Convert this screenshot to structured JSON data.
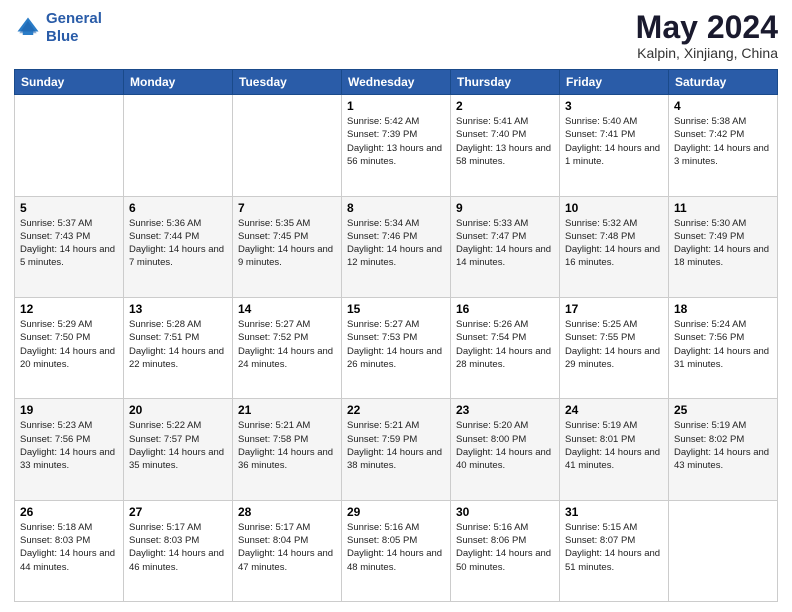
{
  "logo": {
    "line1": "General",
    "line2": "Blue"
  },
  "title": "May 2024",
  "subtitle": "Kalpin, Xinjiang, China",
  "days_of_week": [
    "Sunday",
    "Monday",
    "Tuesday",
    "Wednesday",
    "Thursday",
    "Friday",
    "Saturday"
  ],
  "weeks": [
    [
      {
        "day": "",
        "sunrise": "",
        "sunset": "",
        "daylight": ""
      },
      {
        "day": "",
        "sunrise": "",
        "sunset": "",
        "daylight": ""
      },
      {
        "day": "",
        "sunrise": "",
        "sunset": "",
        "daylight": ""
      },
      {
        "day": "1",
        "sunrise": "Sunrise: 5:42 AM",
        "sunset": "Sunset: 7:39 PM",
        "daylight": "Daylight: 13 hours and 56 minutes."
      },
      {
        "day": "2",
        "sunrise": "Sunrise: 5:41 AM",
        "sunset": "Sunset: 7:40 PM",
        "daylight": "Daylight: 13 hours and 58 minutes."
      },
      {
        "day": "3",
        "sunrise": "Sunrise: 5:40 AM",
        "sunset": "Sunset: 7:41 PM",
        "daylight": "Daylight: 14 hours and 1 minute."
      },
      {
        "day": "4",
        "sunrise": "Sunrise: 5:38 AM",
        "sunset": "Sunset: 7:42 PM",
        "daylight": "Daylight: 14 hours and 3 minutes."
      }
    ],
    [
      {
        "day": "5",
        "sunrise": "Sunrise: 5:37 AM",
        "sunset": "Sunset: 7:43 PM",
        "daylight": "Daylight: 14 hours and 5 minutes."
      },
      {
        "day": "6",
        "sunrise": "Sunrise: 5:36 AM",
        "sunset": "Sunset: 7:44 PM",
        "daylight": "Daylight: 14 hours and 7 minutes."
      },
      {
        "day": "7",
        "sunrise": "Sunrise: 5:35 AM",
        "sunset": "Sunset: 7:45 PM",
        "daylight": "Daylight: 14 hours and 9 minutes."
      },
      {
        "day": "8",
        "sunrise": "Sunrise: 5:34 AM",
        "sunset": "Sunset: 7:46 PM",
        "daylight": "Daylight: 14 hours and 12 minutes."
      },
      {
        "day": "9",
        "sunrise": "Sunrise: 5:33 AM",
        "sunset": "Sunset: 7:47 PM",
        "daylight": "Daylight: 14 hours and 14 minutes."
      },
      {
        "day": "10",
        "sunrise": "Sunrise: 5:32 AM",
        "sunset": "Sunset: 7:48 PM",
        "daylight": "Daylight: 14 hours and 16 minutes."
      },
      {
        "day": "11",
        "sunrise": "Sunrise: 5:30 AM",
        "sunset": "Sunset: 7:49 PM",
        "daylight": "Daylight: 14 hours and 18 minutes."
      }
    ],
    [
      {
        "day": "12",
        "sunrise": "Sunrise: 5:29 AM",
        "sunset": "Sunset: 7:50 PM",
        "daylight": "Daylight: 14 hours and 20 minutes."
      },
      {
        "day": "13",
        "sunrise": "Sunrise: 5:28 AM",
        "sunset": "Sunset: 7:51 PM",
        "daylight": "Daylight: 14 hours and 22 minutes."
      },
      {
        "day": "14",
        "sunrise": "Sunrise: 5:27 AM",
        "sunset": "Sunset: 7:52 PM",
        "daylight": "Daylight: 14 hours and 24 minutes."
      },
      {
        "day": "15",
        "sunrise": "Sunrise: 5:27 AM",
        "sunset": "Sunset: 7:53 PM",
        "daylight": "Daylight: 14 hours and 26 minutes."
      },
      {
        "day": "16",
        "sunrise": "Sunrise: 5:26 AM",
        "sunset": "Sunset: 7:54 PM",
        "daylight": "Daylight: 14 hours and 28 minutes."
      },
      {
        "day": "17",
        "sunrise": "Sunrise: 5:25 AM",
        "sunset": "Sunset: 7:55 PM",
        "daylight": "Daylight: 14 hours and 29 minutes."
      },
      {
        "day": "18",
        "sunrise": "Sunrise: 5:24 AM",
        "sunset": "Sunset: 7:56 PM",
        "daylight": "Daylight: 14 hours and 31 minutes."
      }
    ],
    [
      {
        "day": "19",
        "sunrise": "Sunrise: 5:23 AM",
        "sunset": "Sunset: 7:56 PM",
        "daylight": "Daylight: 14 hours and 33 minutes."
      },
      {
        "day": "20",
        "sunrise": "Sunrise: 5:22 AM",
        "sunset": "Sunset: 7:57 PM",
        "daylight": "Daylight: 14 hours and 35 minutes."
      },
      {
        "day": "21",
        "sunrise": "Sunrise: 5:21 AM",
        "sunset": "Sunset: 7:58 PM",
        "daylight": "Daylight: 14 hours and 36 minutes."
      },
      {
        "day": "22",
        "sunrise": "Sunrise: 5:21 AM",
        "sunset": "Sunset: 7:59 PM",
        "daylight": "Daylight: 14 hours and 38 minutes."
      },
      {
        "day": "23",
        "sunrise": "Sunrise: 5:20 AM",
        "sunset": "Sunset: 8:00 PM",
        "daylight": "Daylight: 14 hours and 40 minutes."
      },
      {
        "day": "24",
        "sunrise": "Sunrise: 5:19 AM",
        "sunset": "Sunset: 8:01 PM",
        "daylight": "Daylight: 14 hours and 41 minutes."
      },
      {
        "day": "25",
        "sunrise": "Sunrise: 5:19 AM",
        "sunset": "Sunset: 8:02 PM",
        "daylight": "Daylight: 14 hours and 43 minutes."
      }
    ],
    [
      {
        "day": "26",
        "sunrise": "Sunrise: 5:18 AM",
        "sunset": "Sunset: 8:03 PM",
        "daylight": "Daylight: 14 hours and 44 minutes."
      },
      {
        "day": "27",
        "sunrise": "Sunrise: 5:17 AM",
        "sunset": "Sunset: 8:03 PM",
        "daylight": "Daylight: 14 hours and 46 minutes."
      },
      {
        "day": "28",
        "sunrise": "Sunrise: 5:17 AM",
        "sunset": "Sunset: 8:04 PM",
        "daylight": "Daylight: 14 hours and 47 minutes."
      },
      {
        "day": "29",
        "sunrise": "Sunrise: 5:16 AM",
        "sunset": "Sunset: 8:05 PM",
        "daylight": "Daylight: 14 hours and 48 minutes."
      },
      {
        "day": "30",
        "sunrise": "Sunrise: 5:16 AM",
        "sunset": "Sunset: 8:06 PM",
        "daylight": "Daylight: 14 hours and 50 minutes."
      },
      {
        "day": "31",
        "sunrise": "Sunrise: 5:15 AM",
        "sunset": "Sunset: 8:07 PM",
        "daylight": "Daylight: 14 hours and 51 minutes."
      },
      {
        "day": "",
        "sunrise": "",
        "sunset": "",
        "daylight": ""
      }
    ]
  ]
}
